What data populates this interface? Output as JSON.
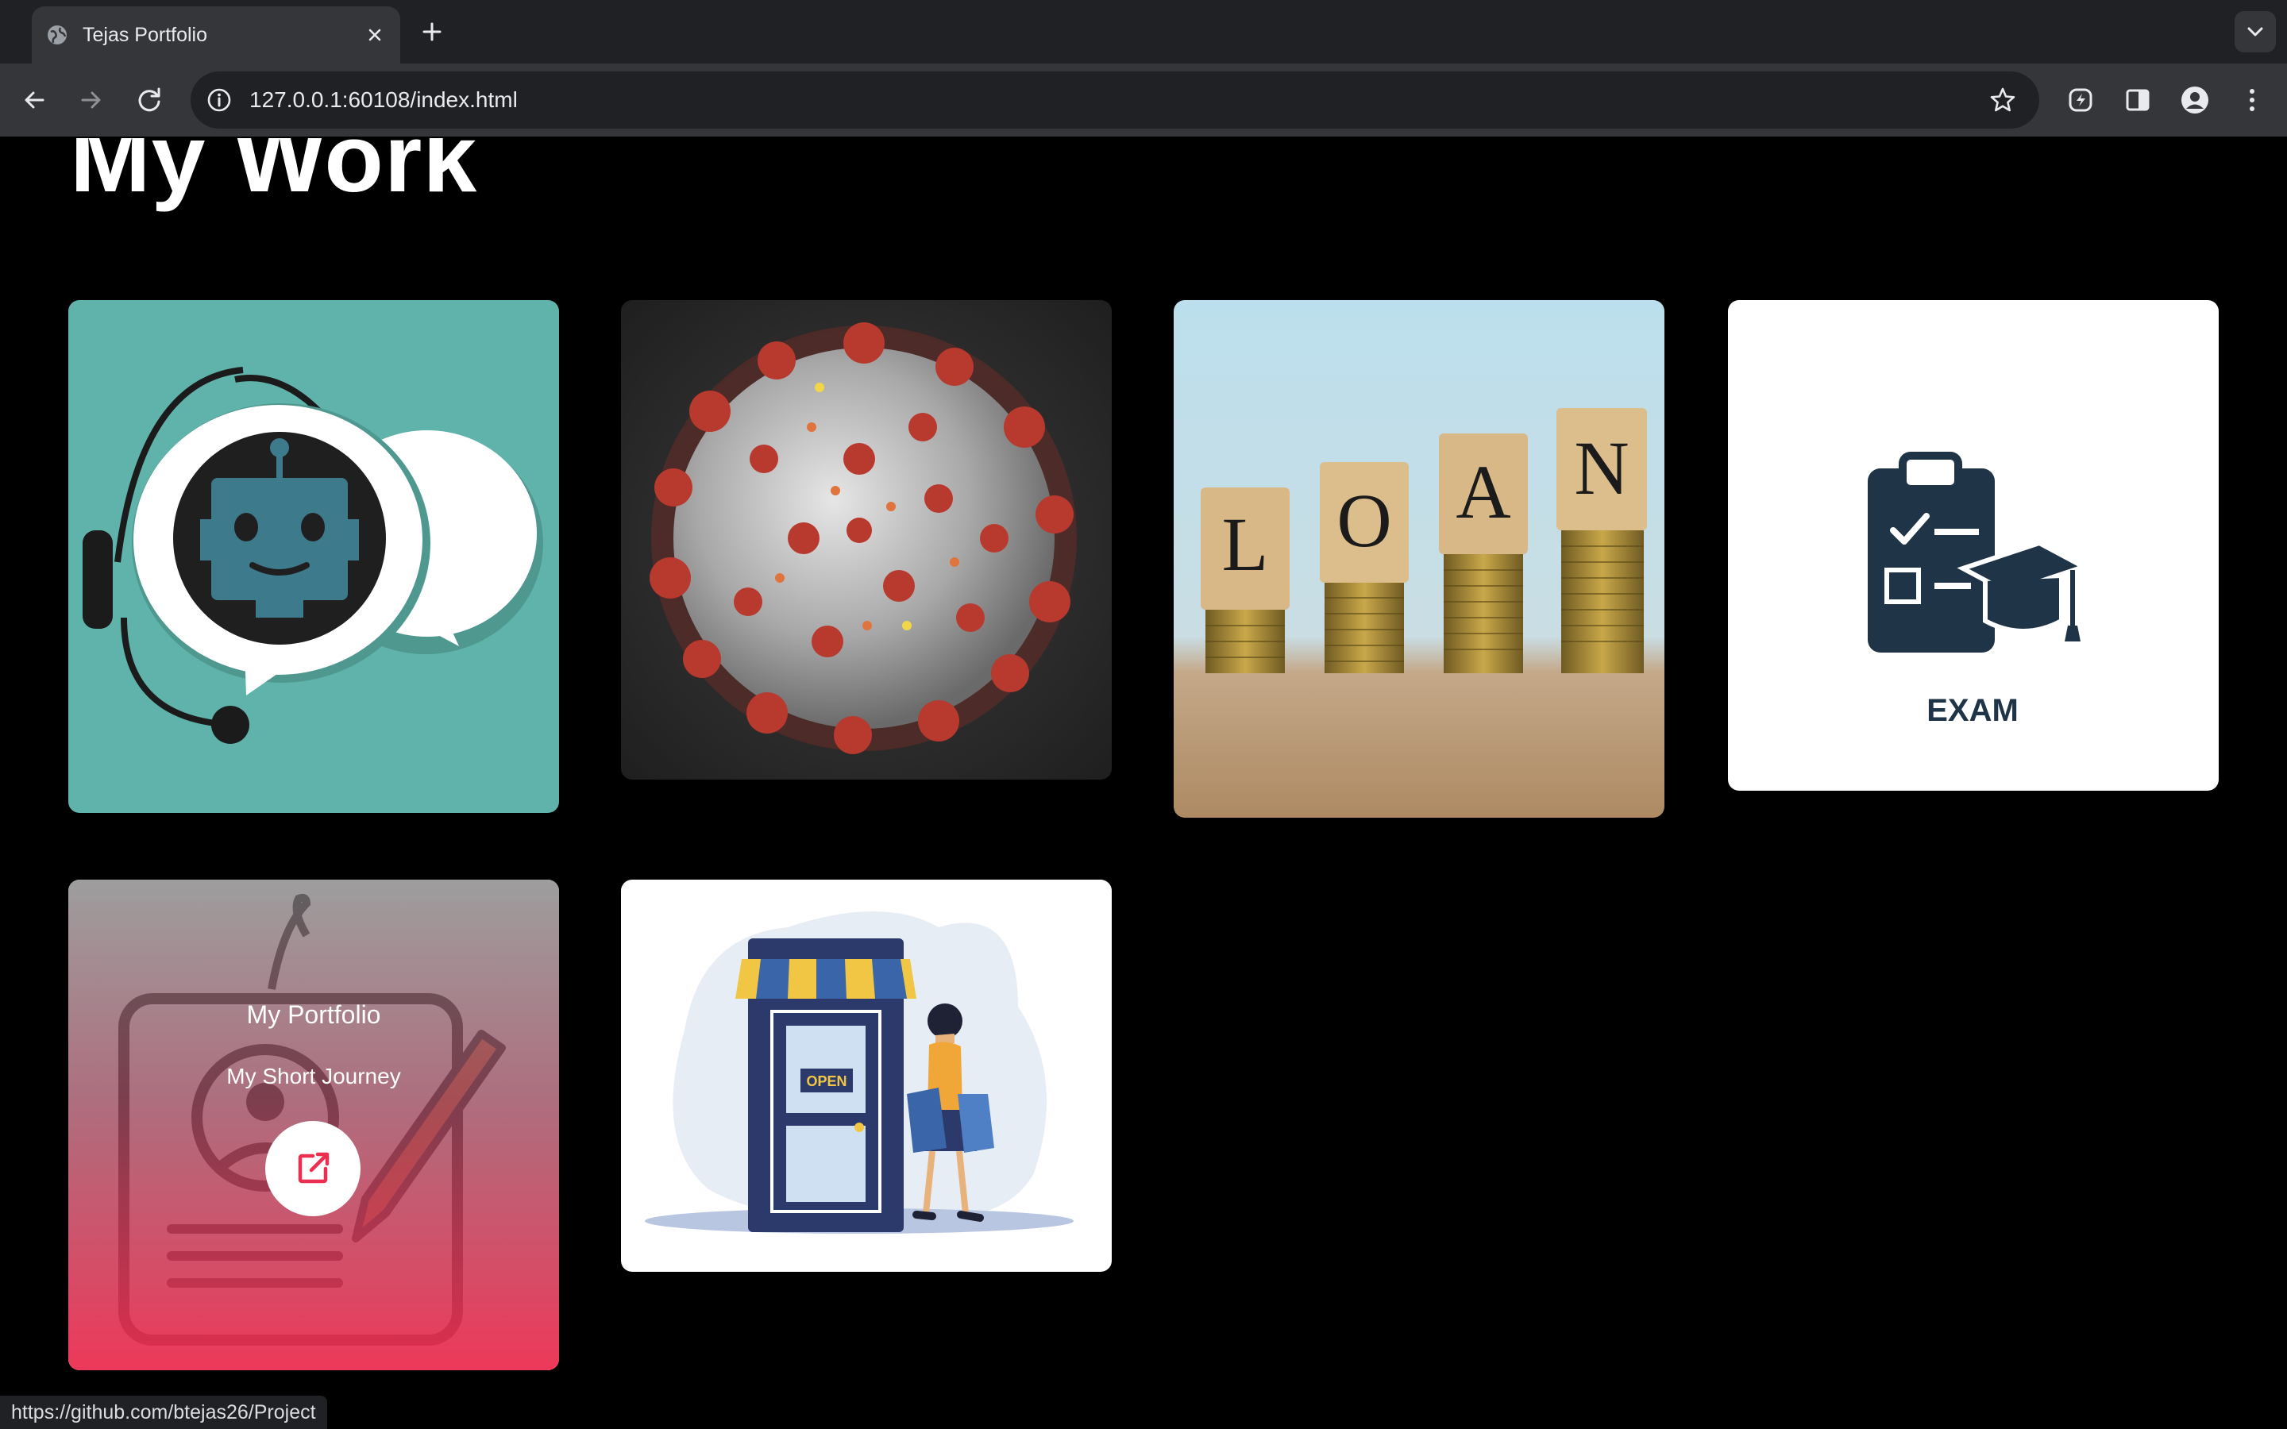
{
  "browser": {
    "tab_title": "Tejas Portfolio",
    "url": "127.0.0.1:60108/index.html",
    "status_url": "https://github.com/btejas26/Project",
    "icons": [
      "globe-icon",
      "close-icon",
      "plus-icon",
      "chevron-down-icon",
      "back-icon",
      "forward-icon",
      "reload-icon",
      "info-icon",
      "star-icon",
      "extension-icon",
      "side-panel-icon",
      "profile-icon",
      "more-icon"
    ]
  },
  "section": {
    "title": "My Work"
  },
  "projects": [
    {
      "image": "chatbot",
      "colors": {
        "background": "#5fb3aa"
      }
    },
    {
      "image": "coronavirus"
    },
    {
      "image": "loan",
      "caption_letters": [
        "L",
        "O",
        "A",
        "N"
      ]
    },
    {
      "image": "exam",
      "caption": "EXAM"
    },
    {
      "image": "portfolio",
      "title": "My Portfolio",
      "subtitle": "My Short Journey",
      "link_icon": "external-link-icon",
      "colors": {
        "overlay_end": "#ec2e50"
      }
    },
    {
      "image": "shopping",
      "sign": "OPEN"
    }
  ]
}
